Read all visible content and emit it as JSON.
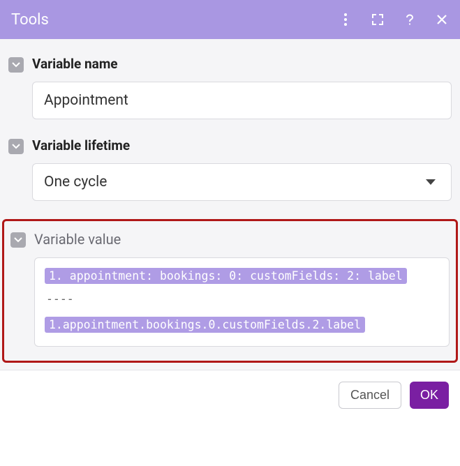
{
  "titlebar": {
    "title": "Tools"
  },
  "sections": {
    "name": {
      "label": "Variable name",
      "value": "Appointment"
    },
    "lifetime": {
      "label": "Variable lifetime",
      "value": "One cycle"
    },
    "value": {
      "label": "Variable value",
      "line1": "1. appointment: bookings: 0: customFields: 2: label",
      "separator": "----",
      "line2": "1.appointment.bookings.0.customFields.2.label"
    }
  },
  "footer": {
    "cancel": "Cancel",
    "ok": "OK"
  }
}
